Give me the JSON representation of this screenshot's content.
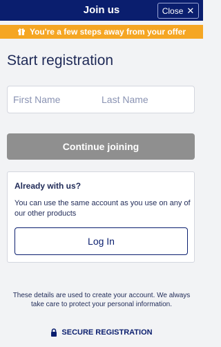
{
  "header": {
    "title": "Join us",
    "close_label": "Close",
    "close_icon": "close-icon"
  },
  "offer_banner": {
    "text": "You're a few steps away from your offer",
    "icon": "gift-icon",
    "color": "#f5a623"
  },
  "registration": {
    "title": "Start registration",
    "first_name_placeholder": "First Name",
    "last_name_placeholder": "Last Name",
    "first_name_value": "",
    "last_name_value": "",
    "continue_label": "Continue joining"
  },
  "existing_account": {
    "title": "Already with us?",
    "text": "You can use the same account as you use on any of our other products",
    "login_label": "Log In"
  },
  "footer": {
    "disclaimer": "These details are used to create your account. We always take care to protect your personal information.",
    "secure_label": "SECURE REGISTRATION",
    "secure_icon": "lock-icon"
  },
  "colors": {
    "brand_navy": "#0a1e6e",
    "disabled_button": "#8f8f8f",
    "background": "#f2f3f5"
  }
}
